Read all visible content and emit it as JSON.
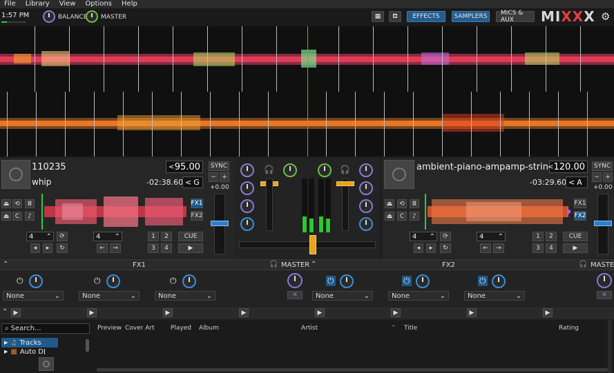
{
  "menu": [
    "File",
    "Library",
    "View",
    "Options",
    "Help"
  ],
  "toolbar": {
    "clock": "1:57 PM",
    "balance_label": "BALANCE",
    "master_label": "MASTER",
    "effects_label": "EFFECTS",
    "samplers_label": "SAMPLERS",
    "mics_label": "MICS & AUX",
    "logo_prefix": "MI",
    "logo_mid": "XX",
    "logo_suffix": "X"
  },
  "deck1": {
    "title": "110235",
    "artist": "whip",
    "bpm": "95.00",
    "bpm_prev": "<",
    "time": "-02:38.60",
    "key": "G",
    "key_prev": "<",
    "sync": "SYNC",
    "rate": "+0.00",
    "fx1": "FX1",
    "fx2": "FX2",
    "beatloop": "4",
    "beatjump": "4",
    "hotcues": [
      "1",
      "2",
      "3",
      "4"
    ],
    "cue": "CUE"
  },
  "deck2": {
    "title": "ambient-piano-ampamp-strin...",
    "bpm": "120.00",
    "bpm_prev": "<",
    "time": "-03:29.60",
    "key": "A",
    "key_prev": "<",
    "sync": "SYNC",
    "rate": "+0.00",
    "fx1": "FX1",
    "fx2": "FX2",
    "beatloop": "4",
    "beatjump": "4",
    "hotcues": [
      "1",
      "2",
      "3",
      "4"
    ],
    "cue": "CUE"
  },
  "mixer": {
    "crossfader": 0.5,
    "vu_left": 0.35,
    "vu_right": 0.35
  },
  "fx": {
    "unit1": {
      "label": "FX1",
      "master": "MASTER",
      "effects": [
        "None",
        "None",
        "None"
      ]
    },
    "unit2": {
      "label": "FX2",
      "master": "MASTER",
      "effects": [
        "None",
        "None",
        "None"
      ]
    }
  },
  "library": {
    "search_placeholder": "Search...",
    "tree": [
      {
        "label": "Tracks",
        "selected": true
      },
      {
        "label": "Auto DJ",
        "selected": false
      }
    ],
    "columns": [
      "Preview",
      "Cover Art",
      "Played",
      "Album",
      "Artist",
      "Title",
      "Rating"
    ]
  },
  "colors": {
    "accent_blue": "#1d5a8a",
    "waveform_red": "#e83a3a",
    "waveform_orange": "#f07a1e",
    "playhead": "#2ecc40",
    "crossfader": "#e8a21c"
  }
}
